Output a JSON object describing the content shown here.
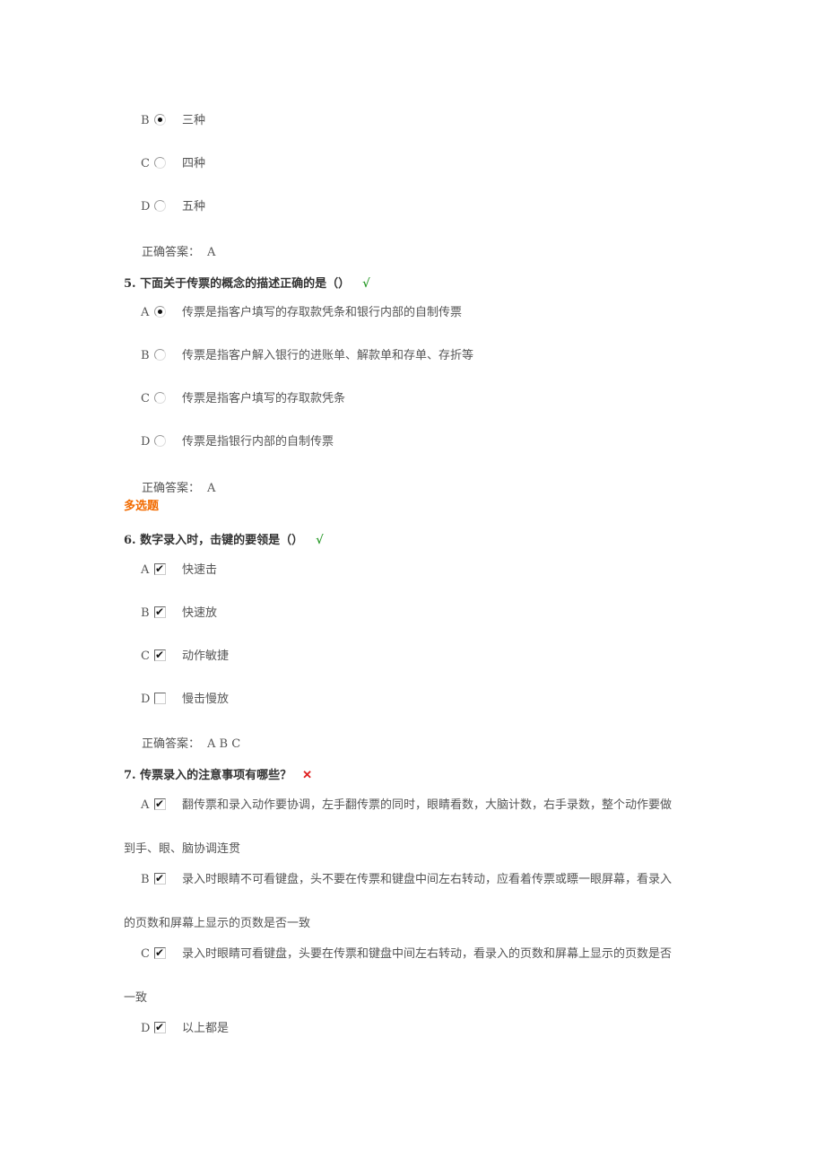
{
  "q4_tail": {
    "options": [
      {
        "letter": "B",
        "text": "三种",
        "selected": true
      },
      {
        "letter": "C",
        "text": "四种",
        "selected": false
      },
      {
        "letter": "D",
        "text": "五种",
        "selected": false
      }
    ],
    "answer_label": "正确答案：",
    "answer": "A"
  },
  "q5": {
    "title": "5.  下面关于传票的概念的描述正确的是（）",
    "result": "correct",
    "result_mark": "√",
    "options": [
      {
        "letter": "A",
        "text": "传票是指客户填写的存取款凭条和银行内部的自制传票",
        "selected": true
      },
      {
        "letter": "B",
        "text": "传票是指客户解入银行的进账单、解款单和存单、存折等",
        "selected": false
      },
      {
        "letter": "C",
        "text": "传票是指客户填写的存取款凭条",
        "selected": false
      },
      {
        "letter": "D",
        "text": "传票是指银行内部的自制传票",
        "selected": false
      }
    ],
    "answer_label": "正确答案：",
    "answer": "A"
  },
  "section_multi": "多选题",
  "q6": {
    "title": "6.  数字录入时，击键的要领是（）",
    "result": "correct",
    "result_mark": "√",
    "options": [
      {
        "letter": "A",
        "text": "快速击",
        "checked": true
      },
      {
        "letter": "B",
        "text": "快速放",
        "checked": true
      },
      {
        "letter": "C",
        "text": "动作敏捷",
        "checked": true
      },
      {
        "letter": "D",
        "text": "慢击慢放",
        "checked": false
      }
    ],
    "answer_label": "正确答案：",
    "answer": "A B C"
  },
  "q7": {
    "title": "7.  传票录入的注意事项有哪些？",
    "result": "wrong",
    "result_mark": "✕",
    "options": [
      {
        "letter": "A",
        "text": "翻传票和录入动作要协调，左手翻传票的同时，眼睛看数，大脑计数，右手录数，整个动作要做",
        "cont": "到手、眼、脑协调连贯",
        "checked": true
      },
      {
        "letter": "B",
        "text": "录入时眼睛不可看键盘，头不要在传票和键盘中间左右转动，应看着传票或瞟一眼屏幕，看录入",
        "cont": "的页数和屏幕上显示的页数是否一致",
        "checked": true
      },
      {
        "letter": "C",
        "text": "录入时眼睛可看键盘，头要在传票和键盘中间左右转动，看录入的页数和屏幕上显示的页数是否",
        "cont": "一致",
        "checked": true
      },
      {
        "letter": "D",
        "text": "以上都是",
        "checked": true
      }
    ]
  },
  "colors": {
    "text": "#555555",
    "section": "#f26b00",
    "correct": "#2a9a2a",
    "wrong": "#e02020"
  }
}
